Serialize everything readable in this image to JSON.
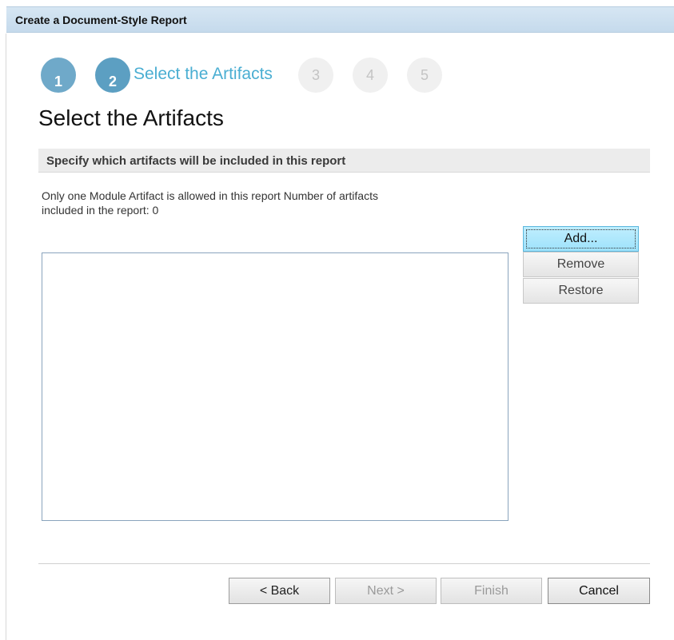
{
  "window": {
    "title": "Create a Document-Style Report"
  },
  "wizard": {
    "steps": [
      {
        "number": "1",
        "state": "done"
      },
      {
        "number": "2",
        "state": "current",
        "label": "Select the Artifacts"
      },
      {
        "number": "3",
        "state": "future"
      },
      {
        "number": "4",
        "state": "future"
      },
      {
        "number": "5",
        "state": "future"
      }
    ]
  },
  "page": {
    "title": "Select the Artifacts",
    "section_header": "Specify which artifacts will be included in this report",
    "info_line1": "Only one Module Artifact is allowed in this report Number of artifacts",
    "info_line2": "included in the report: 0"
  },
  "artifacts": {
    "items": [],
    "buttons": {
      "add": "Add...",
      "remove": "Remove",
      "restore": "Restore"
    }
  },
  "footer": {
    "back": "< Back",
    "next": "Next >",
    "finish": "Finish",
    "cancel": "Cancel"
  },
  "colors": {
    "accent": "#4aaed2",
    "step_active": "#5c9fc2",
    "title_bar": "#c5daec"
  }
}
